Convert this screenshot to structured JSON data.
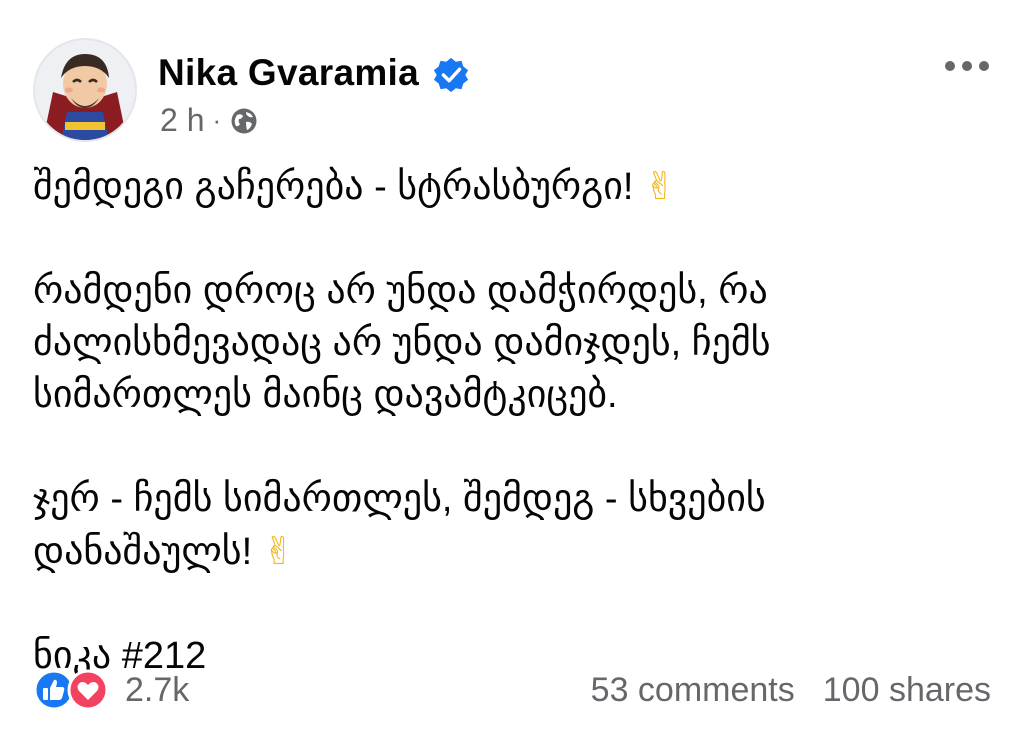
{
  "author": {
    "name": "Nika Gvaramia",
    "time": "2 h",
    "separator": "·"
  },
  "post": {
    "paragraphs": [
      {
        "lines": [
          "შემდეგი გაჩერება - სტრასბურგი!"
        ],
        "emoji": "✌"
      },
      {
        "lines": [
          "რამდენი დროც არ უნდა დამჭირდეს, რა",
          "ძალისხმევადაც არ უნდა დამიჯდეს, ჩემს",
          "სიმართლეს მაინც დავამტკიცებ."
        ],
        "emoji": ""
      },
      {
        "lines": [
          "ჯერ - ჩემს სიმართლეს, შემდეგ - სხვების",
          "დანაშაულს!"
        ],
        "emoji": "✌"
      },
      {
        "lines": [
          "ნიკა #212"
        ],
        "emoji": ""
      }
    ]
  },
  "stats": {
    "reactions": "2.7k",
    "comments": "53 comments",
    "shares": "100 shares"
  },
  "icons": {
    "verified": "verified-badge-icon",
    "privacy": "globe-icon",
    "more": "more-options-icon",
    "like": "like-icon",
    "love": "love-icon"
  },
  "colors": {
    "verified": "#1877f2",
    "meta_text": "#65676b",
    "like": "#1877f2",
    "love": "#f3425f"
  }
}
